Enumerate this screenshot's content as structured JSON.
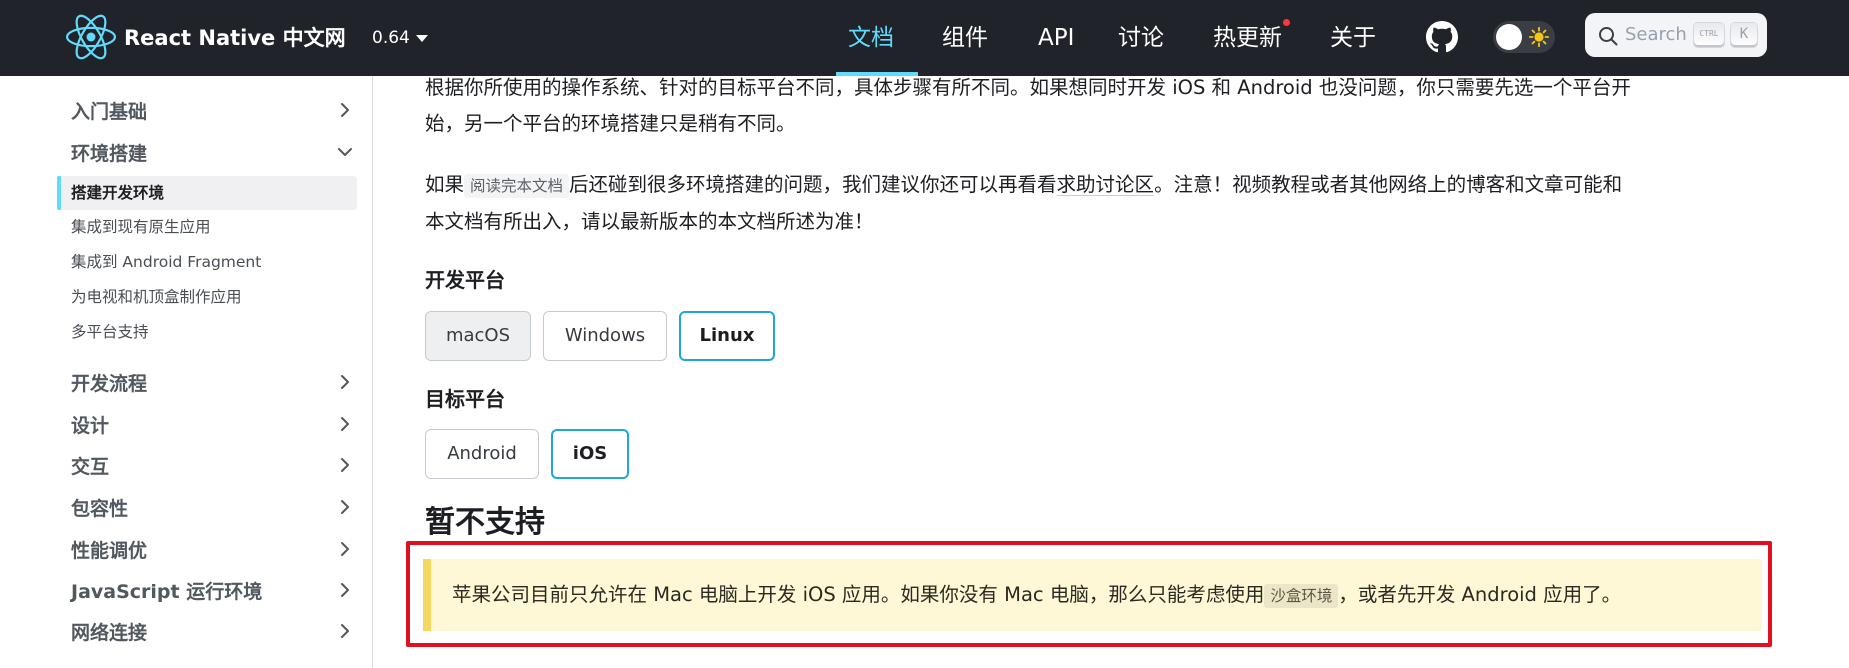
{
  "navbar": {
    "brand": "React Native 中文网",
    "version": "0.64",
    "links": [
      "文档",
      "组件",
      "API",
      "讨论",
      "热更新",
      "关于"
    ],
    "search": {
      "placeholder": "Search",
      "key1": "CTRL",
      "key2": "K"
    },
    "icons": {
      "logo": "react-logo-icon",
      "github": "github-icon",
      "theme": "sun-icon",
      "search": "search-icon"
    },
    "accent": "#61dafb"
  },
  "sidebar": {
    "categories": [
      {
        "label": "入门基础",
        "expanded": false
      },
      {
        "label": "环境搭建",
        "expanded": true
      },
      {
        "label": "开发流程",
        "expanded": false
      },
      {
        "label": "设计",
        "expanded": false
      },
      {
        "label": "交互",
        "expanded": false
      },
      {
        "label": "包容性",
        "expanded": false
      },
      {
        "label": "性能调优",
        "expanded": false
      },
      {
        "label": "JavaScript 运行环境",
        "expanded": false
      },
      {
        "label": "网络连接",
        "expanded": false
      }
    ],
    "subitems": [
      {
        "label": "搭建开发环境",
        "active": true
      },
      {
        "label": "集成到现有原生应用"
      },
      {
        "label": "集成到 Android Fragment"
      },
      {
        "label": "为电视和机顶盒制作应用"
      },
      {
        "label": "多平台支持"
      }
    ]
  },
  "content": {
    "para1_line1": "根据你所使用的操作系统、针对的目标平台不同，具体步骤有所不同。如果想同时开发 iOS 和 Android 也没问题，你只需要先选一个平台开",
    "para1_line2": "始，另一个平台的环境搭建只是稍有不同。",
    "para2_a": "如果",
    "para2_code": "阅读完本文档",
    "para2_b": "后还碰到很多环境搭建的问题，我们建议你还可以再看看",
    "para2_link": "求助讨论区",
    "para2_c": "。注意！视频教程或者其他网络上的博客和文章可能和",
    "para2_line2": "本文档有所出入，请以最新版本的本文档所述为准！",
    "dev_platform_heading": "开发平台",
    "dev_platforms": [
      "macOS",
      "Windows",
      "Linux"
    ],
    "dev_platform_selected": "Linux",
    "target_platform_heading": "目标平台",
    "target_platforms": [
      "Android",
      "iOS"
    ],
    "target_platform_selected": "iOS",
    "unsupported_heading": "暂不支持",
    "alert_a": "苹果公司目前只允许在 Mac 电脑上开发 iOS 应用。如果你没有 Mac 电脑，那么只能考虑使用",
    "alert_code": "沙盒环境",
    "alert_b": "，或者先开发 Android 应用了。"
  }
}
